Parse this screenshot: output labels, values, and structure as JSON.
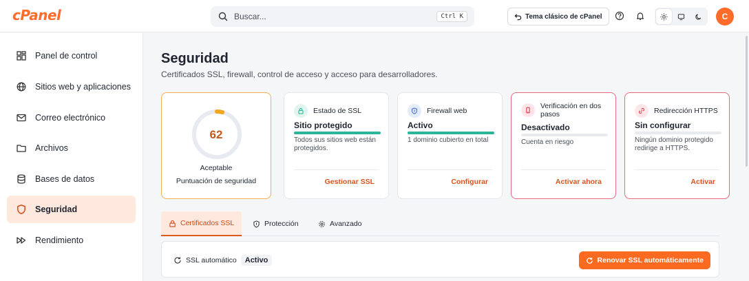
{
  "brand": {
    "logo_text": "cPanel",
    "accent": "#ff6c2c"
  },
  "header": {
    "search_placeholder": "Buscar...",
    "search_shortcut": "Ctrl K",
    "theme_button_label": "Tema clásico de cPanel",
    "help_icon": "question-icon",
    "notifications_icon": "bell-icon",
    "theme_modes": [
      "sun-icon",
      "monitor-icon",
      "moon-icon"
    ],
    "avatar_initial": "C"
  },
  "sidebar": {
    "items": [
      {
        "label": "Panel de control",
        "icon": "dashboard-icon",
        "active": false
      },
      {
        "label": "Sitios web y aplicaciones",
        "icon": "globe-icon",
        "active": false
      },
      {
        "label": "Correo electrónico",
        "icon": "mail-icon",
        "active": false
      },
      {
        "label": "Archivos",
        "icon": "folder-icon",
        "active": false
      },
      {
        "label": "Bases de datos",
        "icon": "database-icon",
        "active": false
      },
      {
        "label": "Seguridad",
        "icon": "shield-icon",
        "active": true
      },
      {
        "label": "Rendimiento",
        "icon": "fast-forward-icon",
        "active": false
      }
    ]
  },
  "main": {
    "title": "Seguridad",
    "subtitle": "Certificados SSL, firewall, control de acceso y acceso para desarrolladores.",
    "score": {
      "value": "62",
      "percent": 62,
      "label": "Aceptable",
      "sub": "Puntuación de seguridad"
    },
    "cards": [
      {
        "head": "Estado de SSL",
        "title": "Sitio protegido",
        "desc": "Todos sus sitios web están protegidos.",
        "action": "Gestionar SSL",
        "progress": 1,
        "icon": "lock-icon",
        "icon_color": "#2bb59a",
        "danger": false
      },
      {
        "head": "Firewall web",
        "title": "Activo",
        "desc": "1 dominio cubierto en total",
        "action": "Configurar",
        "progress": 1,
        "icon": "shield-icon",
        "icon_color": "#4b6fd6",
        "danger": false
      },
      {
        "head": "Verificación en dos pasos",
        "title": "Desactivado",
        "desc": "Cuenta en riesgo",
        "action": "Activar ahora",
        "progress": 0,
        "icon": "phone-icon",
        "icon_color": "#e5394f",
        "danger": true
      },
      {
        "head": "Redirección HTTPS",
        "title": "Sin configurar",
        "desc": "Ningún dominio protegido redirige a HTTPS.",
        "action": "Activar",
        "progress": 0,
        "icon": "link-icon",
        "icon_color": "#e5394f",
        "danger": true
      }
    ],
    "tabs": [
      {
        "label": "Certificados SSL",
        "icon": "lock-icon",
        "active": true
      },
      {
        "label": "Protección",
        "icon": "shield-icon",
        "active": false
      },
      {
        "label": "Avanzado",
        "icon": "gear-icon",
        "active": false
      }
    ],
    "ssl_panel": {
      "label": "SSL automático",
      "status": "Activo",
      "button": "Renovar SSL automáticamente"
    }
  }
}
